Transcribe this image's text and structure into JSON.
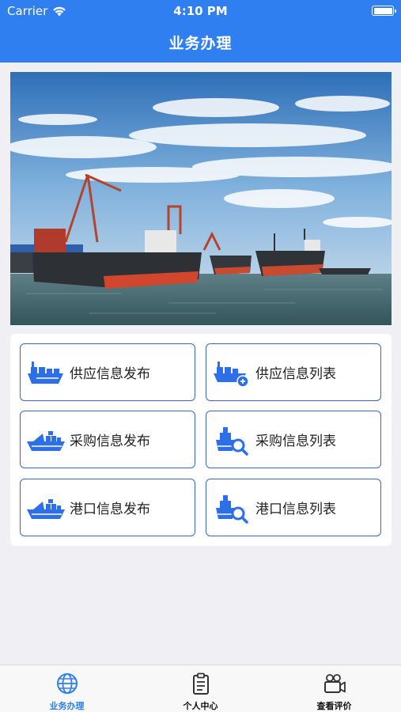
{
  "status_bar": {
    "carrier": "Carrier",
    "time": "4:10 PM"
  },
  "header": {
    "title": "业务办理"
  },
  "banner": {
    "image_name": "cargo-ships-port-photo"
  },
  "tiles": [
    {
      "label": "供应信息发布",
      "icon": "cargo-ship-publish-icon"
    },
    {
      "label": "供应信息列表",
      "icon": "cargo-ship-list-icon"
    },
    {
      "label": "采购信息发布",
      "icon": "container-ship-publish-icon"
    },
    {
      "label": "采购信息列表",
      "icon": "ship-search-icon"
    },
    {
      "label": "港口信息发布",
      "icon": "container-ship-publish-icon"
    },
    {
      "label": "港口信息列表",
      "icon": "ship-search-icon"
    }
  ],
  "tabbar": {
    "items": [
      {
        "label": "业务办理",
        "icon": "globe-icon",
        "active": true
      },
      {
        "label": "个人中心",
        "icon": "clipboard-icon",
        "active": false
      },
      {
        "label": "查看评价",
        "icon": "video-camera-icon",
        "active": false
      }
    ]
  },
  "colors": {
    "primary": "#2f7ff0",
    "tile_border": "#3b66c9",
    "icon_blue": "#2d6fe8",
    "active_tab": "#2f7ff0"
  }
}
